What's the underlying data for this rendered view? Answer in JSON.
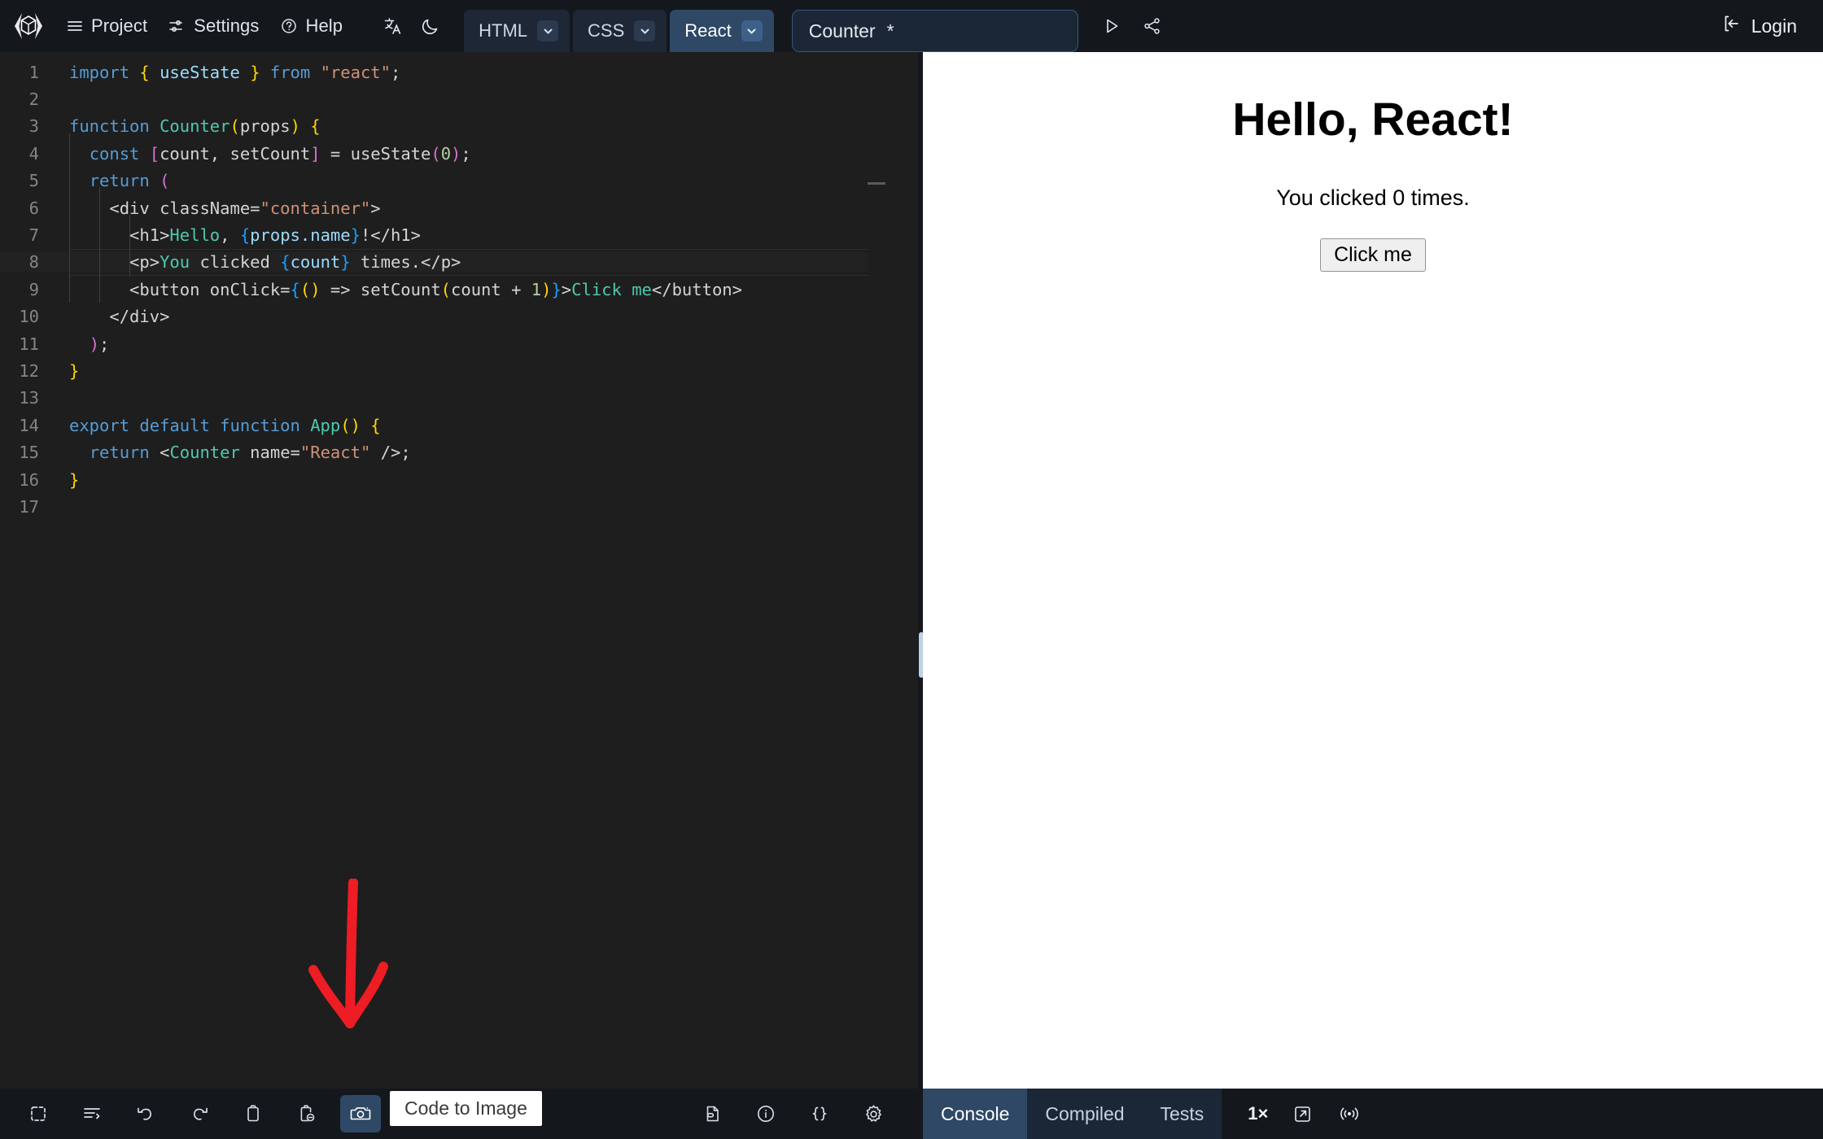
{
  "app": {
    "logo_name": "code-cube-logo",
    "accent_blue": "#2e4865",
    "topbar_bg": "#14181d",
    "editor_bg": "#1e1e1e",
    "annotation_color": "#ee1c24"
  },
  "topbar": {
    "menu": [
      {
        "label": "Project",
        "icon": "hamburger-menu-icon"
      },
      {
        "label": "Settings",
        "icon": "sliders-icon"
      },
      {
        "label": "Help",
        "icon": "question-circle-icon"
      }
    ],
    "translate_icon": "translate-icon",
    "theme_icon": "moon-icon",
    "lang_tabs": [
      {
        "label": "HTML",
        "active": false
      },
      {
        "label": "CSS",
        "active": false
      },
      {
        "label": "React",
        "active": true
      }
    ],
    "file_tab": {
      "name": "Counter",
      "modified_marker": "*"
    },
    "actions": [
      {
        "name": "run-button",
        "icon": "play-icon"
      },
      {
        "name": "share-button",
        "icon": "share-icon"
      }
    ],
    "login_label": "Login",
    "login_icon": "login-arrow-icon"
  },
  "editor": {
    "active_line": 8,
    "lines": [
      {
        "n": "1",
        "tokens": [
          [
            "t-kw",
            "import"
          ],
          [
            "t-pl",
            " "
          ],
          [
            "t-brc",
            "{"
          ],
          [
            "t-pl",
            " "
          ],
          [
            "t-var",
            "useState"
          ],
          [
            "t-pl",
            " "
          ],
          [
            "t-brc",
            "}"
          ],
          [
            "t-pl",
            " "
          ],
          [
            "t-kw",
            "from"
          ],
          [
            "t-pl",
            " "
          ],
          [
            "t-str",
            "\"react\""
          ],
          [
            "t-pl",
            ";"
          ]
        ]
      },
      {
        "n": "2",
        "tokens": []
      },
      {
        "n": "3",
        "tokens": [
          [
            "t-kw",
            "function"
          ],
          [
            "t-pl",
            " "
          ],
          [
            "t-fn",
            "Counter"
          ],
          [
            "t-brc",
            "("
          ],
          [
            "t-pl",
            "props"
          ],
          [
            "t-brc",
            ")"
          ],
          [
            "t-pl",
            " "
          ],
          [
            "t-brc",
            "{"
          ]
        ]
      },
      {
        "n": "4",
        "tokens": [
          [
            "t-pl",
            "  "
          ],
          [
            "t-kw",
            "const"
          ],
          [
            "t-pl",
            " "
          ],
          [
            "t-brc2",
            "["
          ],
          [
            "t-pl",
            "count, setCount"
          ],
          [
            "t-brc2",
            "]"
          ],
          [
            "t-pl",
            " = useState"
          ],
          [
            "t-brc2",
            "("
          ],
          [
            "t-num",
            "0"
          ],
          [
            "t-brc2",
            ")"
          ],
          [
            "t-pl",
            ";"
          ]
        ]
      },
      {
        "n": "5",
        "tokens": [
          [
            "t-pl",
            "  "
          ],
          [
            "t-kw",
            "return"
          ],
          [
            "t-pl",
            " "
          ],
          [
            "t-brc2",
            "("
          ]
        ]
      },
      {
        "n": "6",
        "tokens": [
          [
            "t-pl",
            "    <div className="
          ],
          [
            "t-str",
            "\"container\""
          ],
          [
            "t-pl",
            ">"
          ]
        ]
      },
      {
        "n": "7",
        "tokens": [
          [
            "t-pl",
            "      <h1>"
          ],
          [
            "t-fn",
            "Hello"
          ],
          [
            "t-pl",
            ", "
          ],
          [
            "t-brc3",
            "{"
          ],
          [
            "t-var",
            "props.name"
          ],
          [
            "t-brc3",
            "}"
          ],
          [
            "t-pl",
            "!</h1>"
          ]
        ]
      },
      {
        "n": "8",
        "tokens": [
          [
            "t-pl",
            "      <p>"
          ],
          [
            "t-fn",
            "You"
          ],
          [
            "t-pl",
            " clicked "
          ],
          [
            "t-brc3",
            "{"
          ],
          [
            "t-var",
            "count"
          ],
          [
            "t-brc3",
            "}"
          ],
          [
            "t-pl",
            " times.</p>"
          ]
        ]
      },
      {
        "n": "9",
        "tokens": [
          [
            "t-pl",
            "      <button onClick="
          ],
          [
            "t-brc3",
            "{"
          ],
          [
            "t-brc",
            "("
          ],
          [
            "t-brc",
            ")"
          ],
          [
            "t-pl",
            " => setCount"
          ],
          [
            "t-brc",
            "("
          ],
          [
            "t-pl",
            "count + "
          ],
          [
            "t-num",
            "1"
          ],
          [
            "t-brc",
            ")"
          ],
          [
            "t-brc3",
            "}"
          ],
          [
            "t-pl",
            ">"
          ],
          [
            "t-fn",
            "Click me"
          ],
          [
            "t-pl",
            "</button>"
          ]
        ]
      },
      {
        "n": "10",
        "tokens": [
          [
            "t-pl",
            "    </div>"
          ]
        ]
      },
      {
        "n": "11",
        "tokens": [
          [
            "t-pl",
            "  "
          ],
          [
            "t-brc2",
            ")"
          ],
          [
            "t-pl",
            ";"
          ]
        ]
      },
      {
        "n": "12",
        "tokens": [
          [
            "t-brc",
            "}"
          ]
        ]
      },
      {
        "n": "13",
        "tokens": []
      },
      {
        "n": "14",
        "tokens": [
          [
            "t-kw",
            "export default function"
          ],
          [
            "t-pl",
            " "
          ],
          [
            "t-fn",
            "App"
          ],
          [
            "t-brc",
            "("
          ],
          [
            "t-brc",
            ")"
          ],
          [
            "t-pl",
            " "
          ],
          [
            "t-brc",
            "{"
          ]
        ]
      },
      {
        "n": "15",
        "tokens": [
          [
            "t-pl",
            "  "
          ],
          [
            "t-kw",
            "return"
          ],
          [
            "t-pl",
            " <"
          ],
          [
            "t-fn",
            "Counter"
          ],
          [
            "t-pl",
            " name="
          ],
          [
            "t-str",
            "\"React\""
          ],
          [
            "t-pl",
            " />;"
          ]
        ]
      },
      {
        "n": "16",
        "tokens": [
          [
            "t-brc",
            "}"
          ]
        ]
      },
      {
        "n": "17",
        "tokens": []
      }
    ]
  },
  "preview": {
    "heading": "Hello, React!",
    "paragraph": "You clicked 0 times.",
    "button_label": "Click me"
  },
  "bottom_toolbar": {
    "left_icons": [
      {
        "name": "select-all-icon",
        "active": false
      },
      {
        "name": "format-code-icon",
        "active": false
      },
      {
        "name": "undo-icon",
        "active": false
      },
      {
        "name": "redo-icon",
        "active": false
      },
      {
        "name": "copy-icon",
        "active": false
      },
      {
        "name": "paste-icon",
        "active": false
      },
      {
        "name": "camera-icon",
        "active": true
      }
    ],
    "right_icons": [
      {
        "name": "file-link-icon",
        "active": false
      },
      {
        "name": "info-icon",
        "active": false
      },
      {
        "name": "braces-icon",
        "active": false
      },
      {
        "name": "gear-icon",
        "active": false
      }
    ],
    "tooltip": "Code to Image"
  },
  "panel": {
    "tabs": [
      {
        "label": "Console",
        "active": true
      },
      {
        "label": "Compiled",
        "active": false
      },
      {
        "label": "Tests",
        "active": false
      }
    ],
    "zoom_label": "1×",
    "tools": [
      {
        "name": "open-external-icon"
      },
      {
        "name": "broadcast-icon"
      }
    ]
  }
}
